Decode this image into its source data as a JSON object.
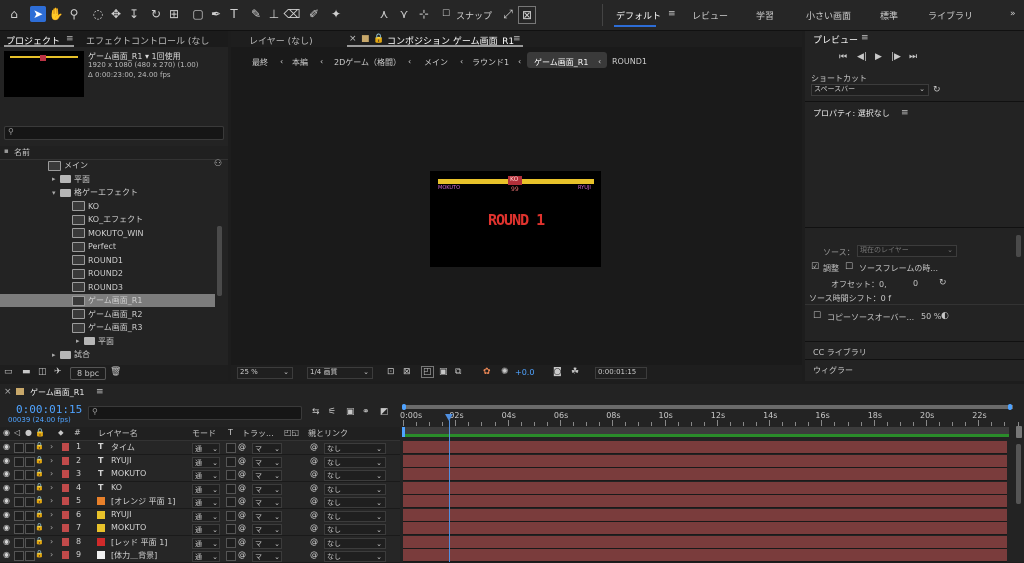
{
  "toolbar": {
    "snap_label": "スナップ",
    "workspaces": [
      "デフォルト",
      "レビュー",
      "学習",
      "小さい画面",
      "標準",
      "ライブラリ"
    ]
  },
  "project_panel": {
    "tab_project": "プロジェクト",
    "tab_effect": "エフェクトコントロール (なし",
    "info": {
      "name": "ゲーム画面_R1 ▾ 1回使用",
      "size": "1920 x 1080  (480 x 270) (1.00)",
      "duration": "Δ 0:00:23:00, 24.00 fps"
    },
    "search_placeholder": "",
    "column_name": "名前",
    "items": [
      {
        "label": "メイン",
        "type": "comp",
        "indent": 0,
        "tri": ""
      },
      {
        "label": "平面",
        "type": "folder",
        "indent": 1,
        "tri": "▸"
      },
      {
        "label": "格ゲーエフェクト",
        "type": "folder",
        "indent": 1,
        "tri": "▾"
      },
      {
        "label": "KO",
        "type": "comp",
        "indent": 2,
        "tri": ""
      },
      {
        "label": "KO_エフェクト",
        "type": "comp",
        "indent": 2,
        "tri": ""
      },
      {
        "label": "MOKUTO_WIN",
        "type": "comp",
        "indent": 2,
        "tri": ""
      },
      {
        "label": "Perfect",
        "type": "comp",
        "indent": 2,
        "tri": ""
      },
      {
        "label": "ROUND1",
        "type": "comp",
        "indent": 2,
        "tri": ""
      },
      {
        "label": "ROUND2",
        "type": "comp",
        "indent": 2,
        "tri": ""
      },
      {
        "label": "ROUND3",
        "type": "comp",
        "indent": 2,
        "tri": ""
      },
      {
        "label": "ゲーム画面_R1",
        "type": "comp",
        "indent": 2,
        "tri": "",
        "selected": true
      },
      {
        "label": "ゲーム画面_R2",
        "type": "comp",
        "indent": 2,
        "tri": ""
      },
      {
        "label": "ゲーム画面_R3",
        "type": "comp",
        "indent": 2,
        "tri": ""
      },
      {
        "label": "平面",
        "type": "folder",
        "indent": 3,
        "tri": "▸"
      },
      {
        "label": "試合",
        "type": "folder",
        "indent": 1,
        "tri": "▸"
      }
    ],
    "bpc": "8 bpc"
  },
  "comp_panel": {
    "tab_layer": "レイヤー (なし)",
    "tab_comp": "コンポジション ゲーム画面_R1",
    "breadcrumbs": [
      "最終",
      "本編",
      "2Dゲーム（格闘）",
      "メイン",
      "ラウンド1",
      "ゲーム画面_R1",
      "ROUND1"
    ],
    "preview": {
      "left_name": "MOKUTO",
      "right_name": "RYUJI",
      "timer_top": "KO",
      "timer": "99",
      "round_text": "ROUND 1"
    },
    "zoom": "25 %",
    "resolution": "1/4 画質",
    "exposure": "+0.0",
    "timecode": "0:00:01:15"
  },
  "right_panel": {
    "preview_title": "プレビュー",
    "shortcut_label": "ショートカット",
    "shortcut_value": "スペースバー",
    "properties_title": "プロパティ: 選択なし",
    "source_label": "ソース：",
    "source_value": "現在のレイヤー",
    "adjust_label": "調整",
    "source_frame_label": "ソースフレームの時...",
    "offset_label": "オフセット：0,",
    "offset_value": "0",
    "time_shift": "ソース時間シフト：0 f",
    "copy_source": "コピーソースオーバー...",
    "copy_pct": "50 %",
    "cc_library": "CC ライブラリ",
    "wiggler": "ウィグラー"
  },
  "timeline": {
    "comp_name": "ゲーム画面_R1",
    "timecode": "0:00:01:15",
    "frames": "00039 (24.00 fps)",
    "headers": {
      "num": "#",
      "layer_name": "レイヤー名",
      "mode": "モード",
      "t": "T",
      "track": "トラッ...",
      "parent": "親とリンク"
    },
    "ruler": [
      "0:00s",
      "02s",
      "04s",
      "06s",
      "08s",
      "10s",
      "12s",
      "14s",
      "16s",
      "18s",
      "20s",
      "22s"
    ],
    "layers": [
      {
        "num": "1",
        "name": "タイム",
        "kind": "T",
        "color": "#c04a4a",
        "mode": "通",
        "track": "マ",
        "parent": "なし"
      },
      {
        "num": "2",
        "name": "RYUJI",
        "kind": "T",
        "color": "#c04a4a",
        "mode": "通",
        "track": "マ",
        "parent": "なし"
      },
      {
        "num": "3",
        "name": "MOKUTO",
        "kind": "T",
        "color": "#c04a4a",
        "mode": "通",
        "track": "マ",
        "parent": "なし"
      },
      {
        "num": "4",
        "name": "KO",
        "kind": "T",
        "color": "#c04a4a",
        "mode": "通",
        "track": "マ",
        "parent": "なし"
      },
      {
        "num": "5",
        "name": "[オレンジ 平面 1]",
        "kind": "solid",
        "color": "#c04a4a",
        "swatch": "#e8802a",
        "mode": "通",
        "track": "マ",
        "parent": "なし"
      },
      {
        "num": "6",
        "name": "RYUJI",
        "kind": "solid",
        "color": "#c04a4a",
        "swatch": "#e8c22a",
        "mode": "通",
        "track": "マ",
        "parent": "なし"
      },
      {
        "num": "7",
        "name": "MOKUTO",
        "kind": "solid",
        "color": "#c04a4a",
        "swatch": "#e8c22a",
        "mode": "通",
        "track": "マ",
        "parent": "なし"
      },
      {
        "num": "8",
        "name": "[レッド 平面 1]",
        "kind": "solid",
        "color": "#c04a4a",
        "swatch": "#d02a2a",
        "mode": "通",
        "track": "マ",
        "parent": "なし"
      },
      {
        "num": "9",
        "name": "[体力＿背景]",
        "kind": "solid",
        "color": "#c04a4a",
        "swatch": "#f0f0f0",
        "mode": "通",
        "track": "マ",
        "parent": "なし"
      }
    ]
  },
  "colors": {
    "accent": "#2d6dd6",
    "track": "#7a3c3c",
    "timecode": "#4fa3ff"
  }
}
